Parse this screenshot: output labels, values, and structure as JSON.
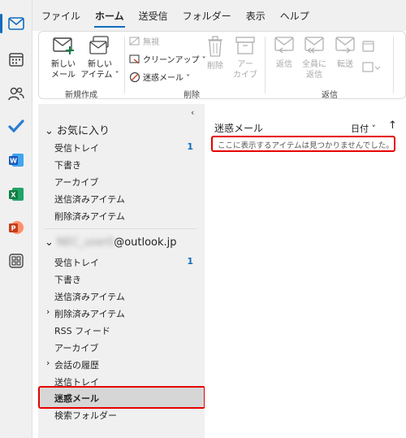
{
  "menu": [
    "ファイル",
    "ホーム",
    "送受信",
    "フォルダー",
    "表示",
    "ヘルプ"
  ],
  "ribbon": {
    "new_mail": [
      "新しい",
      "メール"
    ],
    "new_item": [
      "新しい",
      "アイテム ˅"
    ],
    "group_new": "新規作成",
    "ignore": "無視",
    "cleanup": "クリーンアップ ˅",
    "junk": "迷惑メール ˅",
    "delete": "削除",
    "archive": [
      "アー",
      "カイブ"
    ],
    "group_delete": "削除",
    "reply": "返信",
    "reply_all": [
      "全員に",
      "返信"
    ],
    "forward": "転送",
    "group_respond": "返信"
  },
  "favorites": {
    "header": "お気に入り",
    "items": [
      {
        "label": "受信トレイ",
        "count": "1"
      },
      {
        "label": "下書き"
      },
      {
        "label": "アーカイブ"
      },
      {
        "label": "送信済みアイテム"
      },
      {
        "label": "削除済みアイテム"
      }
    ]
  },
  "account": {
    "name_blurred": "NEC_user0",
    "domain": "@outlook.jp",
    "items": [
      {
        "label": "受信トレイ",
        "count": "1"
      },
      {
        "label": "下書き"
      },
      {
        "label": "送信済みアイテム"
      },
      {
        "label": "削除済みアイテム",
        "expandable": true
      },
      {
        "label": "RSS フィード"
      },
      {
        "label": "アーカイブ"
      },
      {
        "label": "会話の履歴",
        "expandable": true
      },
      {
        "label": "送信トレイ"
      },
      {
        "label": "迷惑メール",
        "selected": true
      },
      {
        "label": "検索フォルダー"
      }
    ]
  },
  "list": {
    "title": "迷惑メール",
    "sort": "日付 ˅",
    "empty_message": "ここに表示するアイテムは見つかりませんでした。"
  },
  "colors": {
    "accent": "#0f6cbd",
    "highlight_red": "#e60000"
  }
}
